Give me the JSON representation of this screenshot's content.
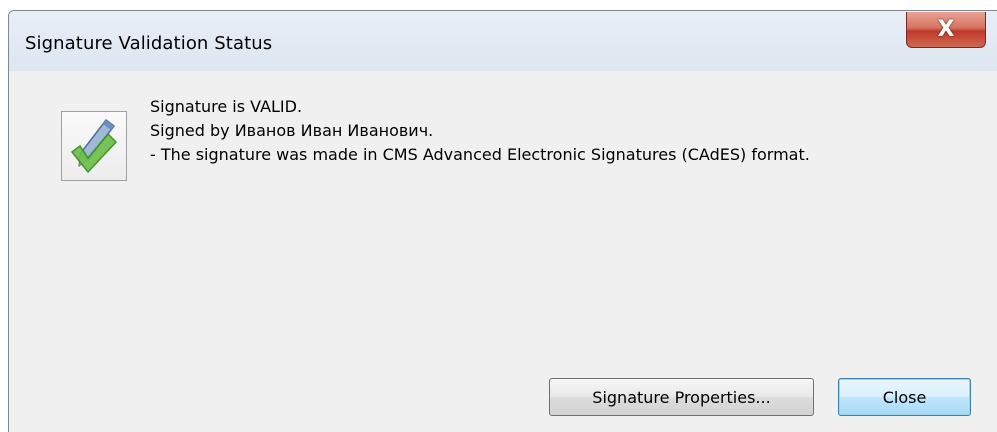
{
  "window": {
    "title": "Signature Validation Status",
    "close_glyph": "X"
  },
  "message": {
    "line1": "Signature is VALID.",
    "line2": "Signed by Иванов Иван Иванович.",
    "line3": "- The signature was made in CMS Advanced Electronic Signatures (CAdES) format."
  },
  "icon": "signature-valid-pen-check-icon",
  "buttons": {
    "properties_label": "Signature Properties...",
    "close_label": "Close"
  }
}
